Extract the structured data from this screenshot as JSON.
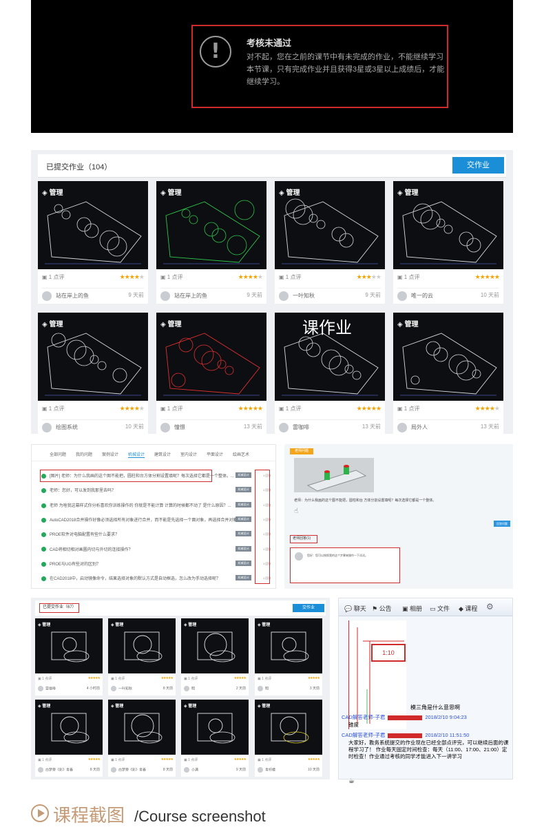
{
  "banner": {
    "title": "考核未通过",
    "body": "对不起，您在之前的课节中有未完成的作业，不能继续学习本节课，只有完成作业并且获得3星或3星以上成绩后，才能继续学习。"
  },
  "submissions": {
    "title": "已提交作业（104）",
    "submit_button": "交作业",
    "tag": "管理",
    "cards": [
      {
        "comments": "1 点评",
        "stars": "★★★★★",
        "rating": 4,
        "user": "站在岸上的鱼",
        "time": "9 天前"
      },
      {
        "comments": "1 点评",
        "stars": "★★★★★",
        "rating": 4,
        "user": "站在岸上的鱼",
        "time": "9 天前"
      },
      {
        "comments": "1 点评",
        "stars": "★★★★★",
        "rating": 3,
        "user": "一叶知秋",
        "time": "9 天前"
      },
      {
        "comments": "1 点评",
        "stars": "★★★★★",
        "rating": 5,
        "user": "唯一的云",
        "time": "10 天前"
      },
      {
        "comments": "1 点评",
        "stars": "★★★★★",
        "rating": 4,
        "user": "绘图系统",
        "time": "10 天前"
      },
      {
        "comments": "1 点评",
        "stars": "★★★★★",
        "rating": 5,
        "user": "憧憬",
        "time": "13 天前"
      },
      {
        "comments": "1 点评",
        "stars": "★★★★★",
        "rating": 5,
        "user": "雷咖啡",
        "time": "13 天前"
      },
      {
        "comments": "1 点评",
        "stars": "★★★★★",
        "rating": 4,
        "user": "局外人",
        "time": "13 天前"
      }
    ],
    "overlay_text": "课作业"
  },
  "forum": {
    "tabs": [
      "全部问题",
      "我的问题",
      "案例设计",
      "机械设计",
      "建筑设计",
      "室内设计",
      "平面设计",
      "绘画艺术"
    ],
    "active_tab": "机械设计",
    "pill": "机械设计",
    "rows": [
      {
        "text": "[图片] 老师：为什么我画的这个图不能把，圆柱和台方体分割设置填呢？每次选择它都是一个整体。...",
        "count": "1 回答"
      },
      {
        "text": "老师：您好，可以发到我那里去吗？",
        "count": "1 回答"
      },
      {
        "text": "老师 为啥我这幕样式你分析喜欢你训练操作的 你就是不能计算 计算的时候都不动了 是什么原因？...",
        "count": "1 回答"
      },
      {
        "text": "AutoCAD2018合并操作好像必须选择所有对象进行合并，而不能是先选择一个面对象，再选择合并对象？...",
        "count": "1 回答"
      },
      {
        "text": "PROE软件对电脑配置有些什么要求？",
        "count": "1 回答"
      },
      {
        "text": "CAD将相切相对画圆内切与外切的连接操作？",
        "count": "1 回答"
      },
      {
        "text": "PROE与UG有些对的区别？",
        "count": "1 回答"
      },
      {
        "text": "在CAD2018中，启动镜像命令，结果选择对象的默认方式是自动框选，怎么改为手动选择呢？",
        "count": "1 回答"
      }
    ]
  },
  "post": {
    "badge": "老师问题",
    "question": "老师：为什么我画的这个图不能把，圆柱和台 方体分割设置填呢？每次选择它都是一个整体。",
    "reply_button": "回答问题",
    "answers_label": "老师回答(1)",
    "answer_text": "您好：您可以按照我的这个步骤来操作一下试试。"
  },
  "hw2": {
    "title": "已提交作业（67）",
    "submit_button": "交作业",
    "tag": "管理",
    "cards": [
      {
        "comments": "1 点评",
        "stars": "★★★★★",
        "user": "雷咖啡",
        "time": "4 小时前"
      },
      {
        "comments": "1 点评",
        "stars": "★★★★★",
        "user": "一叶知秋",
        "time": "8 天前"
      },
      {
        "comments": "1 点评",
        "stars": "★★★★★",
        "user": "明",
        "time": "2 天前"
      },
      {
        "comments": "1 点评",
        "stars": "★★★★★",
        "user": "明",
        "time": "3 天前"
      },
      {
        "comments": "1 点评",
        "stars": "★★★★★",
        "user": "白梦旁《彩》青春",
        "time": "8 天前"
      },
      {
        "comments": "1 点评",
        "stars": "★★★★★",
        "user": "白梦旁《彩》青春",
        "time": "8 天前"
      },
      {
        "comments": "1 点评",
        "stars": "★★★★★",
        "user": "小满",
        "time": "9 天前"
      },
      {
        "comments": "1 点评",
        "stars": "★★★★★",
        "user": "青柠檬",
        "time": "10 天前"
      }
    ]
  },
  "chat": {
    "tabs": [
      "聊天",
      "公告",
      "相册",
      "文件",
      "课程"
    ],
    "scale_label": "1:10",
    "question": "模三角是什么意思啊",
    "messages": [
      {
        "name": "CAD解答老师-子君",
        "time": "2018/2/10 9:04:23",
        "text": "锥度"
      },
      {
        "name": "CAD解答老师-子君",
        "time": "2018/2/10 11:51:50",
        "text": "大家好，教务系统提交的作业现在已经全部点评完，可以继续后面的课程学习了！\n作业每天固定时间检查：每天（11:00、17:00、21:00）定时检查！作业通过考核的同学才能进入下一讲学习"
      }
    ]
  },
  "footer": {
    "title_zh": "课程截图",
    "title_en": "/Course screenshot"
  },
  "colors": {
    "accent": "#1b8ed8",
    "star": "#f5a300",
    "highlight": "#d02a2a",
    "footer": "#c49b76",
    "tag_green": "#24a85b"
  }
}
